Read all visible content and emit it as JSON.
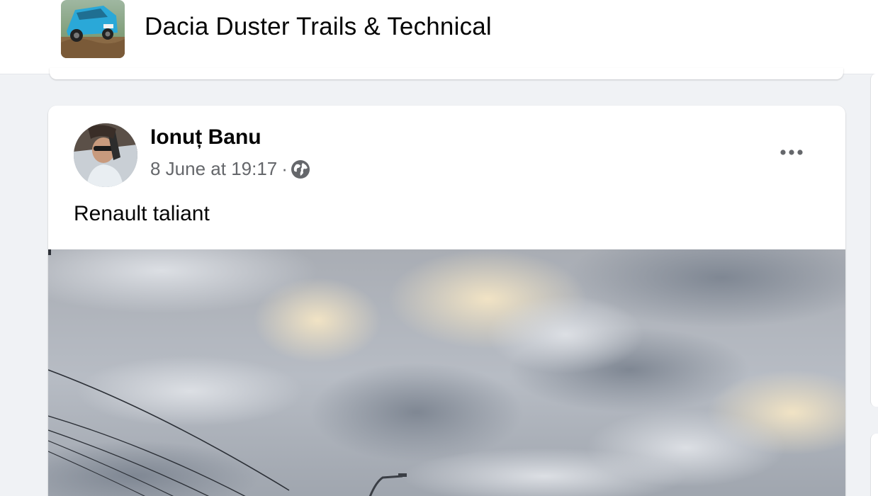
{
  "group": {
    "name": "Dacia Duster Trails & Technical",
    "thumbnail_icon": "group-cover-photo-icon"
  },
  "post": {
    "author": "Ionuț Banu",
    "timestamp": "8 June at 19:17",
    "separator": "·",
    "audience_icon": "globe-icon",
    "more_icon": "more-options-icon",
    "text": "Renault taliant",
    "image_icon": "post-photo"
  },
  "colors": {
    "background": "#f0f2f5",
    "card": "#ffffff",
    "primary_text": "#050505",
    "secondary_text": "#65676b"
  }
}
